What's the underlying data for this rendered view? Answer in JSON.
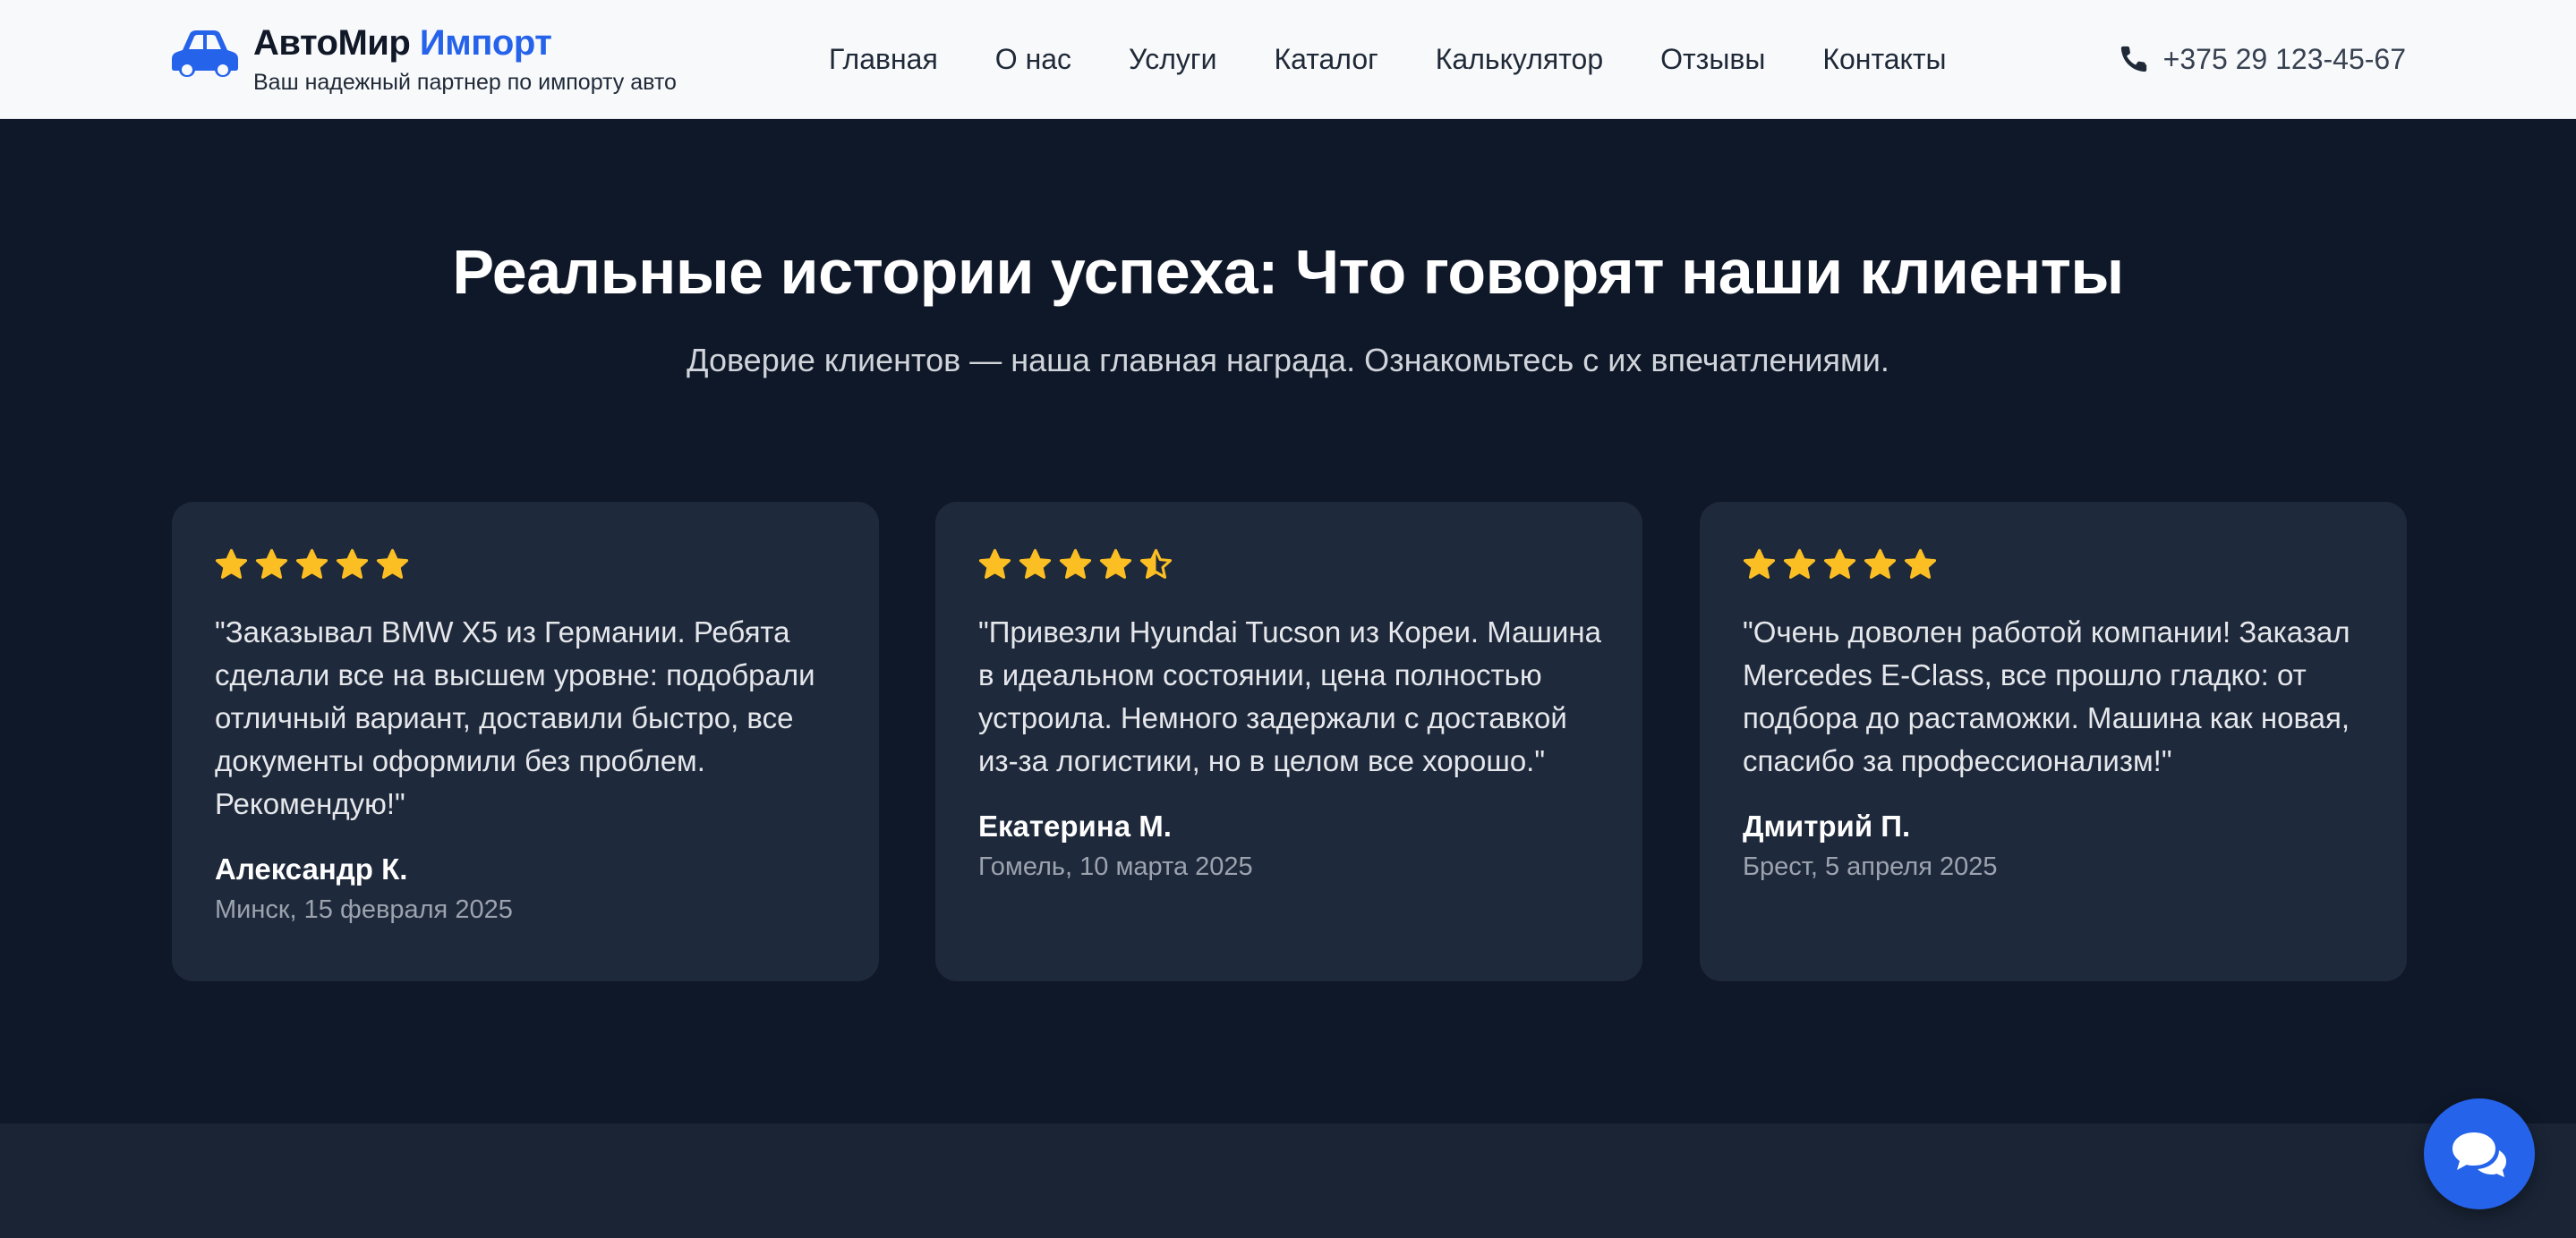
{
  "header": {
    "brand_main": "АвтоМир",
    "brand_accent": "Импорт",
    "tagline": "Ваш надежный партнер по импорту авто",
    "logo_icon": "car-icon",
    "nav": [
      {
        "label": "Главная"
      },
      {
        "label": "О нас"
      },
      {
        "label": "Услуги"
      },
      {
        "label": "Каталог"
      },
      {
        "label": "Калькулятор"
      },
      {
        "label": "Отзывы"
      },
      {
        "label": "Контакты"
      }
    ],
    "phone_icon": "phone-icon",
    "phone": "+375 29 123-45-67"
  },
  "section": {
    "title": "Реальные истории успеха: Что говорят наши клиенты",
    "subtitle": "Доверие клиентов — наша главная награда. Ознакомьтесь с их впечатлениями."
  },
  "reviews": [
    {
      "rating": 5,
      "quote": "\"Заказывал BMW X5 из Германии. Ребята сделали все на высшем уровне: подобрали отличный вариант, доставили быстро, все документы оформили без проблем. Рекомендую!\"",
      "author": "Александр К.",
      "meta": "Минск, 15 февраля 2025"
    },
    {
      "rating": 4.5,
      "quote": "\"Привезли Hyundai Tucson из Кореи. Машина в идеальном состоянии, цена полностью устроила. Немного задержали с доставкой из-за логистики, но в целом все хорошо.\"",
      "author": "Екатерина М.",
      "meta": "Гомель, 10 марта 2025"
    },
    {
      "rating": 5,
      "quote": "\"Очень доволен работой компании! Заказал Mercedes E-Class, все прошло гладко: от подбора до растаможки. Машина как новая, спасибо за профессионализм!\"",
      "author": "Дмитрий П.",
      "meta": "Брест, 5 апреля 2025"
    }
  ],
  "chat_icon": "chat-bubbles-icon",
  "colors": {
    "accent": "#2563eb",
    "star": "#fbbf24",
    "section_bg": "#0f1828",
    "card_bg": "#1e293b"
  }
}
